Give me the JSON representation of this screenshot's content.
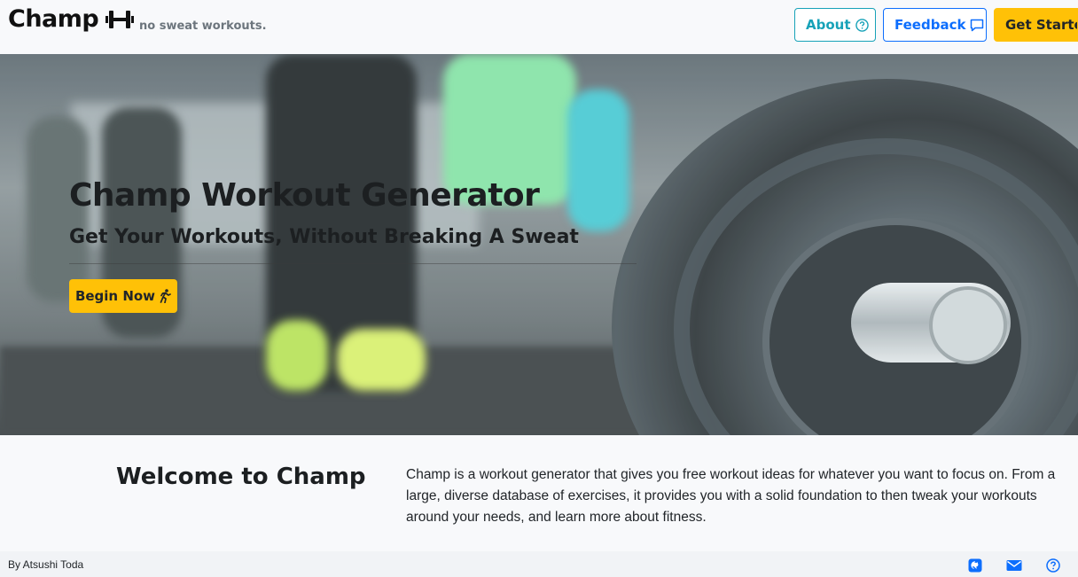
{
  "header": {
    "brand": "Champ",
    "brand_icon": "dumbbell-icon",
    "tagline": "no sweat workouts.",
    "nav": {
      "about_label": "About",
      "about_icon": "question-circle-icon",
      "feedback_label": "Feedback",
      "feedback_icon": "chat-bubble-icon",
      "get_started_label": "Get Started"
    }
  },
  "hero": {
    "title": "Champ Workout Generator",
    "subtitle": "Get Your Workouts, Without Breaking A Sweat",
    "cta_label": "Begin Now",
    "cta_icon": "running-person-icon"
  },
  "welcome": {
    "title": "Welcome to Champ",
    "text": "Champ is a workout generator that gives you free workout ideas for whatever you want to focus on. From a large, diverse database of exercises, it provides you with a solid foundation to then tweak your workouts around your needs, and learn more about fitness."
  },
  "footer": {
    "author": "By Atsushi Toda",
    "icons": [
      "github-icon",
      "envelope-icon",
      "question-circle-icon"
    ]
  },
  "colors": {
    "accent_yellow": "#ffc107",
    "about_teal": "#17a2b8",
    "feedback_blue": "#0d6efd"
  }
}
